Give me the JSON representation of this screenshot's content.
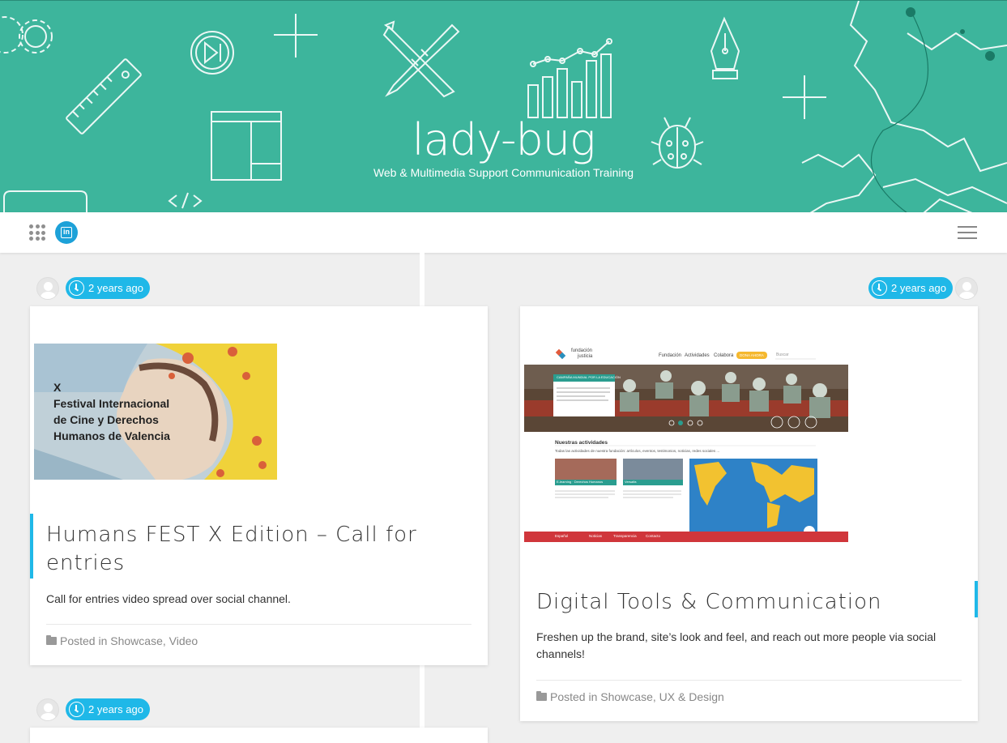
{
  "header": {
    "site_title": "lady-bug",
    "tagline": "Web & Multimedia Support Communication Training",
    "background_color": "#3db59c"
  },
  "toolbar": {
    "apps_icon": "grid-dots-icon",
    "linkedin_icon": "linkedin-icon",
    "linkedin_label": "in",
    "menu_icon": "hamburger-menu-icon"
  },
  "posts": [
    {
      "date": "2 years ago",
      "image": {
        "description_text": [
          "X",
          "Festival Internacional",
          "de Cine y Derechos",
          "Humanos de Valencia"
        ]
      },
      "title": "Humans FEST X Edition – Call for entries",
      "excerpt": "Call for entries video spread over social channel.",
      "posted_in_label": "Posted in",
      "categories": [
        "Showcase",
        "Video"
      ]
    },
    {
      "date": "2 years ago",
      "image": {
        "logo_text_1": "fundación",
        "logo_text_2": "justicia",
        "nav": [
          "Fundación",
          "Actividades",
          "Colabora"
        ],
        "donate": "DONA AHORA",
        "search": "Buscar",
        "banner_title": "CAMPAÑA MUNDIAL POR LA EDUCACIÓN",
        "section_title": "Nuestras actividades",
        "section_subtitle": "Todas las actividades de nuestra fundación: artículos, eventos, testimonios, noticias, redes sociales ...",
        "card_labels": [
          "E-learning · Derechos Humanos",
          "Versalfa"
        ],
        "footer_items": [
          "Español",
          "Noticias",
          "Transparencia",
          "Contacto"
        ]
      },
      "title": "Digital Tools & Communication",
      "excerpt": "Freshen up the brand, site’s look and feel, and reach out more people via social channels!",
      "posted_in_label": "Posted in",
      "categories": [
        "Showcase",
        "UX & Design"
      ]
    },
    {
      "date": "2 years ago"
    }
  ],
  "colors": {
    "accent": "#1fb8e8",
    "page_bg": "#efefef"
  }
}
